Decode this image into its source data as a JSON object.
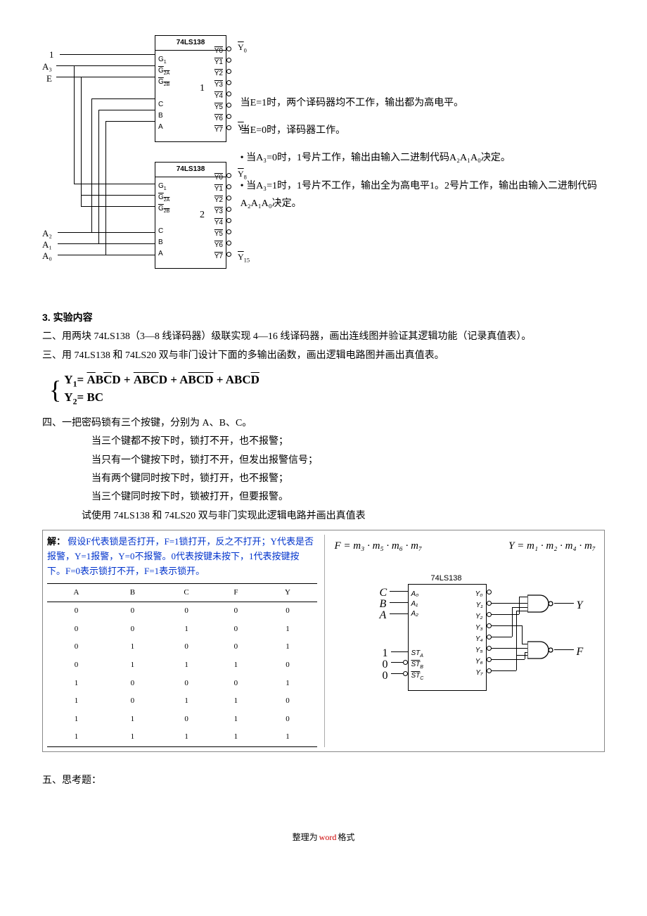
{
  "diagram1": {
    "chip_label": "74LS138",
    "inputs_top": [
      "1",
      "A₃",
      "E"
    ],
    "inputs_bottom": [
      "A₂",
      "A₁",
      "A₀"
    ],
    "pins_left": [
      "G₁",
      "G̅₂ₐ",
      "G̅₂ᵦ",
      "C",
      "B",
      "A"
    ],
    "pins_right": [
      "Y̅0",
      "Y̅1",
      "Y̅2",
      "Y̅3",
      "Y̅4",
      "Y̅5",
      "Y̅6",
      "Y̅7"
    ],
    "chip_nums": [
      "1",
      "2"
    ],
    "outputs": [
      "Y̅₀",
      "Y̅₇",
      "Y̅₈",
      "Y̅₁₅"
    ],
    "notes": [
      "当E=1时，两个译码器均不工作，输出都为高电平。",
      "当E=0时，译码器工作。",
      "• 当A₃=0时，1号片工作，输出由输入二进制代码A₂A₁A₀决定。",
      "• 当A₃=1时，1号片不工作，输出全为高电平1。2号片工作，输出由输入二进制代码A₂A₁A₀决定。"
    ]
  },
  "section3": {
    "head": "3. 实验内容",
    "p1": "二、用两块 74LS138（3—8 线译码器）级联实现 4—16 线译码器，画出连线图并验证其逻辑功能（记录真值表）。",
    "p2": "三、用 74LS138 和 74LS20 双与非门设计下面的多输出函数，画出逻辑电路图并画出真值表。"
  },
  "formula": {
    "y1_label": "Y₁=",
    "y1_terms": [
      "A̅BC̅D",
      "A̅B̅C̅D",
      "AB̅C̅D̅",
      "ABCD̅"
    ],
    "y2_label": "Y₂=",
    "y2_terms": "BC"
  },
  "section4": {
    "head": "四、一把密码锁有三个按键，分别为 A、B、C。",
    "lines": [
      "当三个键都不按下时，锁打不开，也不报警；",
      "当只有一个键按下时，锁打不开，但发出报警信号；",
      "当有两个键同时按下时，锁打开，也不报警；",
      "当三个键同时按下时，锁被打开，但要报警。"
    ],
    "last": "试使用 74LS138 和 74LS20 双与非门实现此逻辑电路并画出真值表"
  },
  "solution": {
    "head": "解：",
    "blue_text": "假设F代表锁是否打开，F=1锁打开，反之不打开；Y代表是否报警，Y=1报警，Y=0不报警。0代表按键未按下，1代表按键按下。F=0表示锁打不开，F=1表示锁开。",
    "table": {
      "headers": [
        "A",
        "B",
        "C",
        "F",
        "Y"
      ],
      "rows": [
        [
          "0",
          "0",
          "0",
          "0",
          "0"
        ],
        [
          "0",
          "0",
          "1",
          "0",
          "1"
        ],
        [
          "0",
          "1",
          "0",
          "0",
          "1"
        ],
        [
          "0",
          "1",
          "1",
          "1",
          "0"
        ],
        [
          "1",
          "0",
          "0",
          "0",
          "1"
        ],
        [
          "1",
          "0",
          "1",
          "1",
          "0"
        ],
        [
          "1",
          "1",
          "0",
          "1",
          "0"
        ],
        [
          "1",
          "1",
          "1",
          "1",
          "1"
        ]
      ]
    },
    "formula_F": "F = m₃ · m₅ · m₆ · m₇",
    "formula_Y": "Y = m₁ · m₂ · m₄ · m₇",
    "chip_label": "74LS138",
    "inputs_abc": [
      "C",
      "B",
      "A"
    ],
    "inputs_st": [
      "1",
      "0",
      "0"
    ],
    "pins_a": [
      "A₀",
      "A₁",
      "A₂"
    ],
    "pins_st": [
      "STₐ",
      "S̅T̅ᵦ",
      "S̅T̅꜀"
    ],
    "pins_y": [
      "Y₀",
      "Y₁",
      "Y₂",
      "Y₃",
      "Y₄",
      "Y₅",
      "Y₆",
      "Y₇"
    ],
    "out_Y": "Y",
    "out_F": "F"
  },
  "section5": "五、思考题：",
  "footer": {
    "t1": "整理为",
    "t2": "word",
    "t3": "格式"
  }
}
